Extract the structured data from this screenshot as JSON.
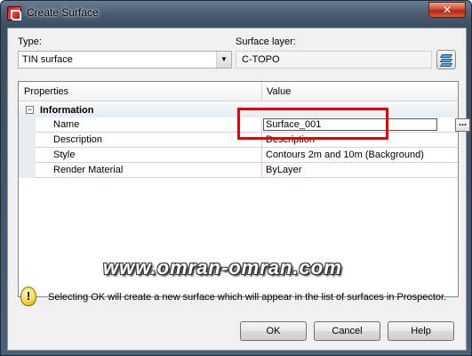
{
  "window": {
    "title": "Create Surface",
    "close_glyph": "✕"
  },
  "type_field": {
    "label": "Type:",
    "value": "TIN surface"
  },
  "layer_field": {
    "label": "Surface layer:",
    "value": "C-TOPO"
  },
  "grid": {
    "col_properties": "Properties",
    "col_value": "Value",
    "category": {
      "expander": "⊟",
      "label": "Information"
    },
    "rows": [
      {
        "name": "Name",
        "value": "Surface_001"
      },
      {
        "name": "Description",
        "value": "Description"
      },
      {
        "name": "Style",
        "value": "Contours 2m and 10m (Background)"
      },
      {
        "name": "Render Material",
        "value": "ByLayer"
      }
    ],
    "ellipsis": "..."
  },
  "watermark": "www.omran-omran.com",
  "info": {
    "icon_glyph": "!",
    "message": "Selecting OK will create a new surface which will appear in the list of surfaces in Prospector."
  },
  "buttons": {
    "ok": "OK",
    "cancel": "Cancel",
    "help": "Help"
  },
  "colors": {
    "highlight": "#e00000",
    "titlebar": "#4a5d71",
    "client": "#f0f0f0"
  }
}
